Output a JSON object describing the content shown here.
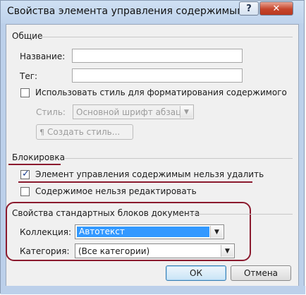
{
  "window": {
    "title": "Свойства элемента управления содержимым",
    "help_glyph": "?",
    "close_glyph": "✕"
  },
  "general": {
    "group_label": "Общие",
    "name_label": "Название:",
    "name_value": "",
    "tag_label": "Тег:",
    "tag_value": "",
    "use_style_label": "Использовать стиль для форматирования содержимого",
    "use_style_checked": false,
    "style_label": "Стиль:",
    "style_value": "Основной шрифт абзаца",
    "new_style_button": "Создать стиль..."
  },
  "locking": {
    "group_label": "Блокировка",
    "cannot_delete_label": "Элемент управления содержимым нельзя удалить",
    "cannot_delete_checked": true,
    "cannot_edit_label": "Содержимое нельзя редактировать",
    "cannot_edit_checked": false
  },
  "building_blocks": {
    "group_label": "Свойства стандартных блоков документа",
    "gallery_label": "Коллекция:",
    "gallery_value": "Автотекст",
    "category_label": "Категория:",
    "category_value": "(Все категории)"
  },
  "actions": {
    "ok_label": "ОК",
    "cancel_label": "Отмена"
  },
  "colors": {
    "accent_highlight": "#3399ff",
    "annotation_red": "#8b1a2e",
    "title_bar": "#bfd3ec",
    "close_button": "#c6452b"
  },
  "icons": {
    "help": "help-icon",
    "close": "close-icon",
    "checkmark": "checkmark-icon",
    "dropdown": "chevron-down-icon",
    "new_style": "new-style-icon"
  }
}
